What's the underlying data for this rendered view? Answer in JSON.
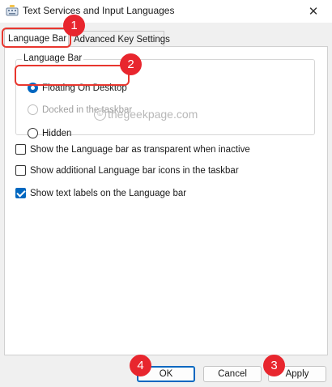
{
  "window": {
    "title": "Text Services and Input Languages",
    "close_glyph": "✕",
    "icon": "keyboard-settings-icon"
  },
  "tabs": [
    {
      "label": "Language Bar",
      "selected": true
    },
    {
      "label": "Advanced Key Settings",
      "selected": false
    }
  ],
  "group": {
    "legend": "Language Bar",
    "options": [
      {
        "label": "Floating On Desktop",
        "checked": true,
        "enabled": true
      },
      {
        "label": "Docked in the taskbar",
        "checked": false,
        "enabled": false
      },
      {
        "label": "Hidden",
        "checked": false,
        "enabled": true
      }
    ]
  },
  "checkboxes": [
    {
      "label": "Show the Language bar as transparent when inactive",
      "checked": false
    },
    {
      "label": "Show additional Language bar icons in the taskbar",
      "checked": false
    },
    {
      "label": "Show text labels on the Language bar",
      "checked": true
    }
  ],
  "watermark": {
    "icon_glyph": "©",
    "text": "thegeekpage.com"
  },
  "buttons": {
    "ok": "OK",
    "cancel": "Cancel",
    "apply": "Apply"
  },
  "markers": [
    "1",
    "2",
    "3",
    "4"
  ],
  "colors": {
    "accent": "#0067c0",
    "annotation": "#e8262e"
  }
}
